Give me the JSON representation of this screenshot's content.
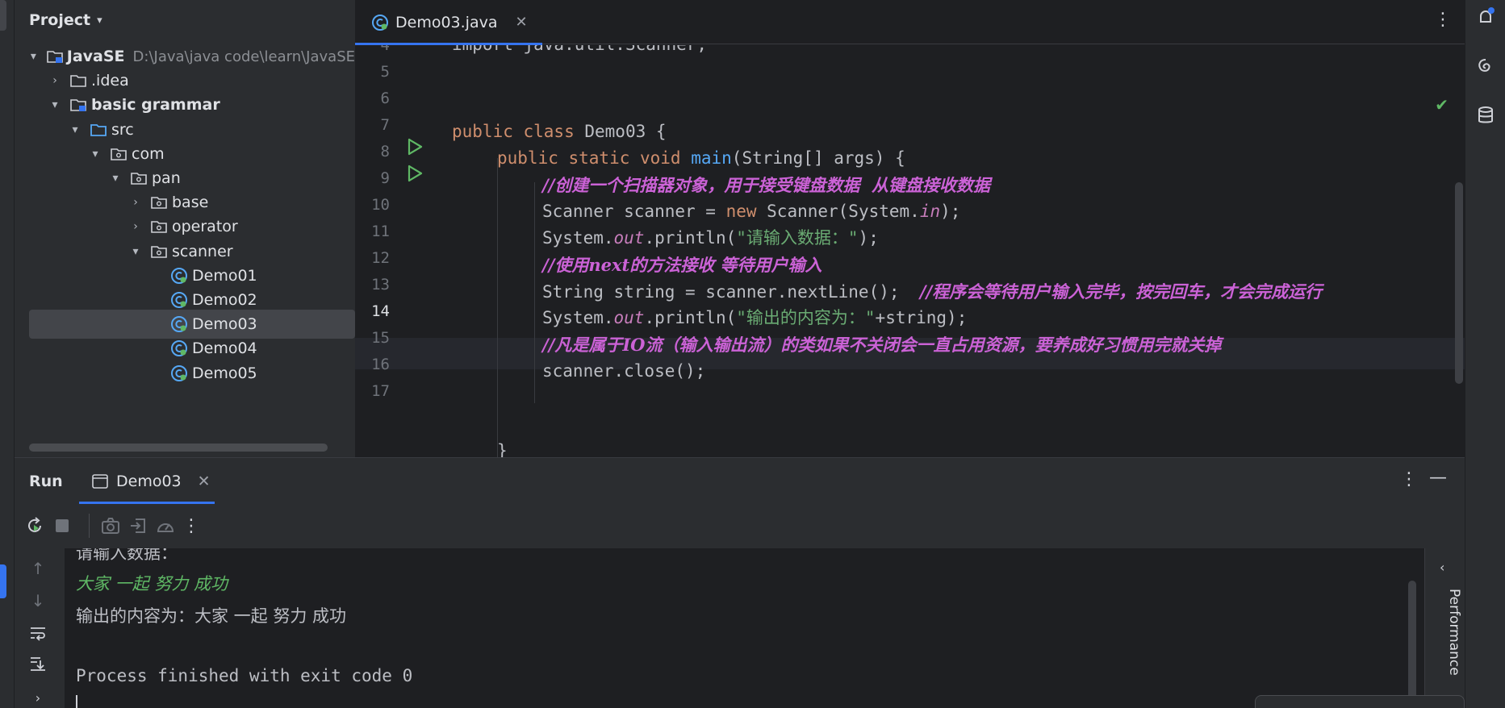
{
  "project": {
    "title": "Project",
    "tree": [
      {
        "label": "JavaSE",
        "path": "D:\\Java\\java code\\learn\\JavaSE",
        "bold": true
      },
      {
        "label": ".idea"
      },
      {
        "label": "basic grammar",
        "bold": true
      },
      {
        "label": "src"
      },
      {
        "label": "com"
      },
      {
        "label": "pan"
      },
      {
        "label": "base"
      },
      {
        "label": "operator"
      },
      {
        "label": "scanner"
      },
      {
        "label": "Demo01"
      },
      {
        "label": "Demo02"
      },
      {
        "label": "Demo03",
        "selected": true
      },
      {
        "label": "Demo04"
      },
      {
        "label": "Demo05"
      }
    ]
  },
  "editor": {
    "tab_label": "Demo03.java",
    "line_numbers": [
      "4",
      "5",
      "6",
      "7",
      "8",
      "9",
      "10",
      "11",
      "12",
      "13",
      "14",
      "15",
      "16",
      "17"
    ],
    "current_line": "14",
    "lines": {
      "l4": "import java.util.Scanner;",
      "l6_kw": "public class ",
      "l6_name": "Demo03 {",
      "l7_kw": "public static void ",
      "l7_fn": "main",
      "l7_rest": "(String[] args) {",
      "l8_cm": "//创建一个扫描器对象，用于接受键盘数据  从键盘接收数据",
      "l9_a": "Scanner scanner = ",
      "l9_kw": "new",
      "l9_b": " Scanner(System.",
      "l9_in": "in",
      "l9_c": ");",
      "l10_a": "System.",
      "l10_out": "out",
      "l10_b": ".println(",
      "l10_str": "\"请输入数据：\"",
      "l10_c": ");",
      "l11_cm": "//使用next的方法接收 等待用户输入",
      "l12_a": "String string = scanner.nextLine();  ",
      "l12_cm": "//程序会等待用户输入完毕，按完回车，才会完成运行",
      "l13_a": "System.",
      "l13_out": "out",
      "l13_b": ".println(",
      "l13_str": "\"输出的内容为：\"",
      "l13_c": "+string);",
      "l14_cm": "//凡是属于IO流（输入输出流）的类如果不关闭会一直占用资源，要养成好习惯用完就关掉",
      "l15": "scanner.close();",
      "l17": "}"
    }
  },
  "run": {
    "title": "Run",
    "tab_label": "Demo03",
    "console": [
      "请输入数据：",
      "大家 一起 努力 成功",
      "输出的内容为：大家 一起 努力 成功",
      "",
      "Process finished with exit code 0"
    ],
    "performance_label": "Performance"
  },
  "colors": {
    "accent": "#3574f0",
    "keyword": "#cf8e6d",
    "string": "#6aab73",
    "comment": "#cb62d6",
    "function": "#56a8f5",
    "run_green": "#5fb865"
  },
  "icons": [
    "chevron-down-icon",
    "chevron-right-icon",
    "folder-icon",
    "module-folder-icon",
    "package-icon",
    "java-class-icon",
    "run-gutter-icon",
    "close-icon",
    "more-vert-icon",
    "minimize-icon",
    "rerun-icon",
    "stop-icon",
    "camera-icon",
    "restore-layout-icon",
    "dashboard-icon",
    "arrow-up-icon",
    "arrow-down-icon",
    "soft-wrap-icon",
    "scroll-to-end-icon",
    "checkmark-icon",
    "notifications-icon",
    "ai-assistant-icon",
    "database-icon"
  ]
}
